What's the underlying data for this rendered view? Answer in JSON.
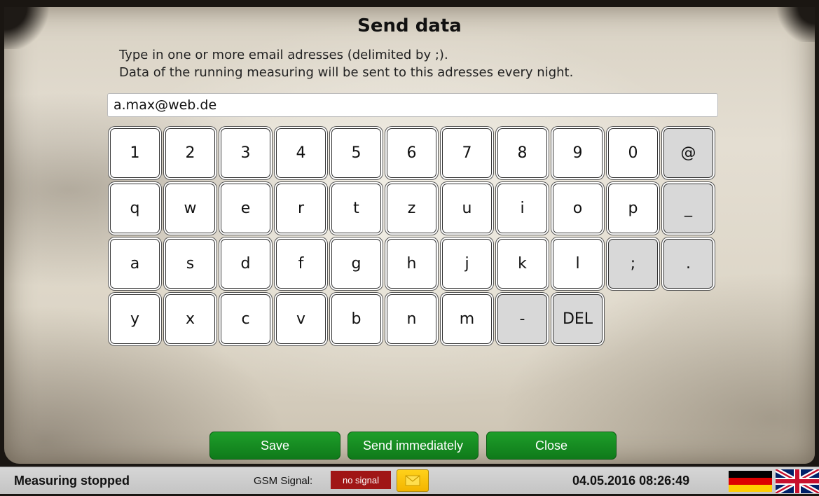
{
  "dialog": {
    "title": "Send data",
    "description_line1": "Type in one or more email adresses (delimited by ;).",
    "description_line2": "Data of the running measuring will be sent to this adresses every night.",
    "email_value": "a.max@web.de"
  },
  "keyboard": {
    "rows": [
      [
        "1",
        "2",
        "3",
        "4",
        "5",
        "6",
        "7",
        "8",
        "9",
        "0",
        "@"
      ],
      [
        "q",
        "w",
        "e",
        "r",
        "t",
        "z",
        "u",
        "i",
        "o",
        "p",
        "_"
      ],
      [
        "a",
        "s",
        "d",
        "f",
        "g",
        "h",
        "j",
        "k",
        "l",
        ";",
        "."
      ],
      [
        "y",
        "x",
        "c",
        "v",
        "b",
        "n",
        "m",
        "-",
        "DEL"
      ]
    ]
  },
  "buttons": {
    "save": "Save",
    "send_immediately": "Send immediately",
    "close": "Close"
  },
  "statusbar": {
    "status": "Measuring stopped",
    "gsm_label": "GSM Signal:",
    "gsm_value": "no signal",
    "datetime": "04.05.2016 08:26:49",
    "mail_icon": "envelope-icon",
    "languages": [
      "german-flag-icon",
      "uk-flag-icon"
    ]
  },
  "colors": {
    "button_green": "#128a20",
    "signal_red": "#a01616",
    "mail_yellow": "#f8c400",
    "special_key": "#d8d8d8"
  }
}
